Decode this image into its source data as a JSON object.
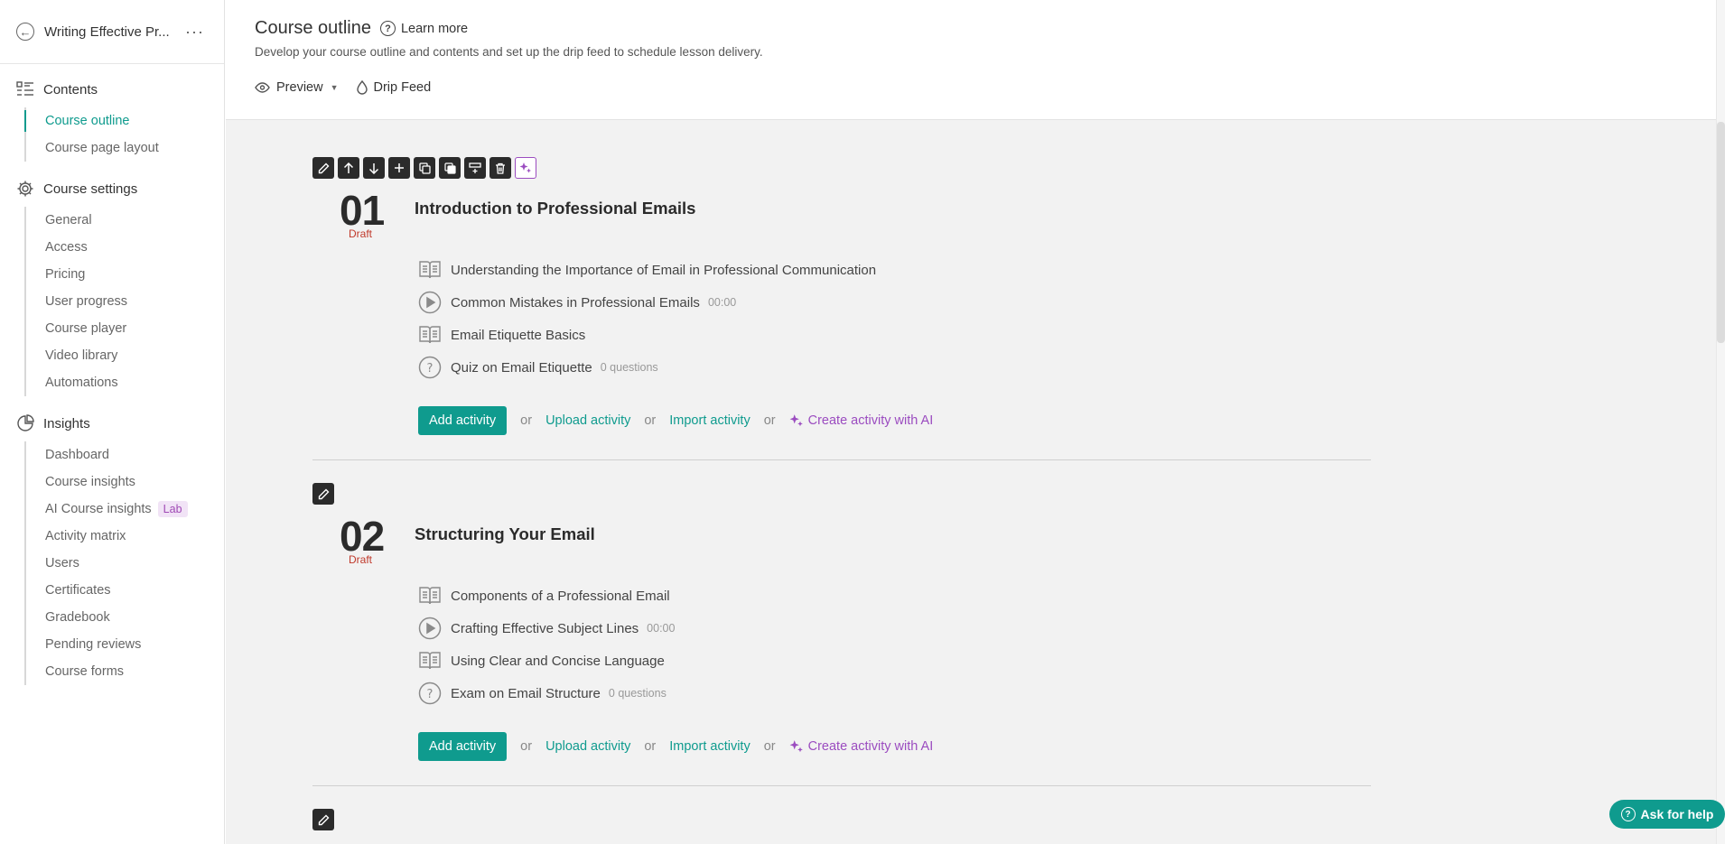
{
  "sidebar": {
    "course_title": "Writing Effective Pr...",
    "sections": [
      {
        "label": "Contents",
        "items": [
          "Course outline",
          "Course page layout"
        ]
      },
      {
        "label": "Course settings",
        "items": [
          "General",
          "Access",
          "Pricing",
          "User progress",
          "Course player",
          "Video library",
          "Automations"
        ]
      },
      {
        "label": "Insights",
        "items": [
          "Dashboard",
          "Course insights",
          "AI Course insights",
          "Activity matrix",
          "Users",
          "Certificates",
          "Gradebook",
          "Pending reviews",
          "Course forms"
        ]
      }
    ],
    "lab_badge": "Lab"
  },
  "header": {
    "title": "Course outline",
    "learn_more": "Learn more",
    "subtitle": "Develop your course outline and contents and set up the drip feed to schedule lesson delivery.",
    "tabs": [
      "Preview",
      "Drip Feed"
    ]
  },
  "modules": [
    {
      "number": "01",
      "status": "Draft",
      "title": "Introduction to Professional Emails",
      "activities": [
        {
          "type": "book-icon",
          "label": "Understanding the Importance of Email in Professional Communication",
          "meta": ""
        },
        {
          "type": "play-icon",
          "label": "Common Mistakes in Professional Emails",
          "meta": "00:00"
        },
        {
          "type": "book-icon",
          "label": "Email Etiquette Basics",
          "meta": ""
        },
        {
          "type": "quiz-icon",
          "label": "Quiz on Email Etiquette",
          "meta": "0 questions"
        }
      ]
    },
    {
      "number": "02",
      "status": "Draft",
      "title": "Structuring Your Email",
      "activities": [
        {
          "type": "book-icon",
          "label": "Components of a Professional Email",
          "meta": ""
        },
        {
          "type": "play-icon",
          "label": "Crafting Effective Subject Lines",
          "meta": "00:00"
        },
        {
          "type": "book-icon",
          "label": "Using Clear and Concise Language",
          "meta": ""
        },
        {
          "type": "quiz-icon",
          "label": "Exam on Email Structure",
          "meta": "0 questions"
        }
      ]
    }
  ],
  "actions": {
    "add_activity": "Add activity",
    "or": "or",
    "upload_activity": "Upload activity",
    "import_activity": "Import activity",
    "create_with_ai": "Create activity with AI"
  },
  "help_button": "Ask for help",
  "colors": {
    "accent": "#0f9b8e",
    "ai_purple": "#9b4cc0",
    "draft_red": "#c0392b"
  }
}
